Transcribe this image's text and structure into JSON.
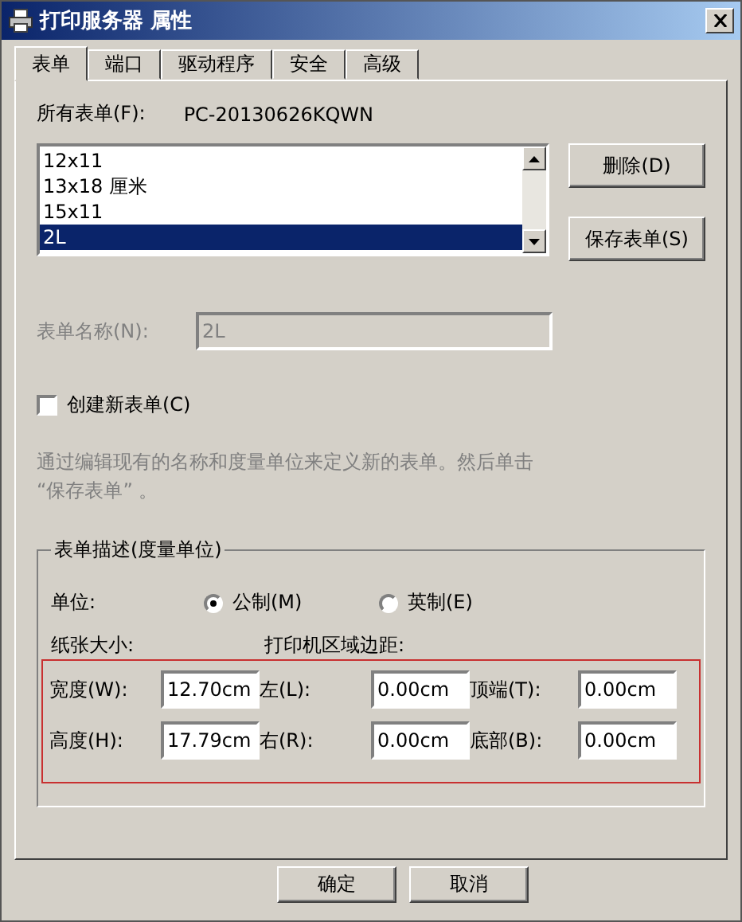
{
  "window": {
    "title": "打印服务器 属性"
  },
  "tabs": [
    {
      "label": "表单",
      "selected": true
    },
    {
      "label": "端口",
      "selected": false
    },
    {
      "label": "驱动程序",
      "selected": false
    },
    {
      "label": "安全",
      "selected": false
    },
    {
      "label": "高级",
      "selected": false
    }
  ],
  "forms": {
    "label": "所有表单(F):",
    "server": "PC-20130626KQWN",
    "items": [
      {
        "label": "12x11",
        "selected": false
      },
      {
        "label": "13x18 厘米",
        "selected": false
      },
      {
        "label": "15x11",
        "selected": false
      },
      {
        "label": "2L",
        "selected": true
      }
    ]
  },
  "side_buttons": [
    "删除(D)",
    "保存表单(S)"
  ],
  "form_name": {
    "label": "表单名称(N):",
    "value": "2L",
    "disabled": true
  },
  "create_new": {
    "label": "创建新表单(C)",
    "checked": false
  },
  "hint": "通过编辑现有的名称和度量单位来定义新的表单。然后单击 “保存表单” 。",
  "description": {
    "title": "表单描述(度量单位)",
    "unit_label": "单位:",
    "units": [
      {
        "label": "公制(M)",
        "selected": true
      },
      {
        "label": "英制(E)",
        "selected": false
      }
    ],
    "paper_label": "纸张大小:",
    "margin_label": "打印机区域边距:",
    "rows": [
      [
        {
          "label": "宽度(W):",
          "value": "12.70cm"
        },
        {
          "label": "左(L):",
          "value": "0.00cm"
        },
        {
          "label": "顶端(T):",
          "value": "0.00cm"
        }
      ],
      [
        {
          "label": "高度(H):",
          "value": "17.79cm"
        },
        {
          "label": "右(R):",
          "value": "0.00cm"
        },
        {
          "label": "底部(B):",
          "value": "0.00cm"
        }
      ]
    ]
  },
  "footer_buttons": [
    "确定",
    "取消"
  ]
}
